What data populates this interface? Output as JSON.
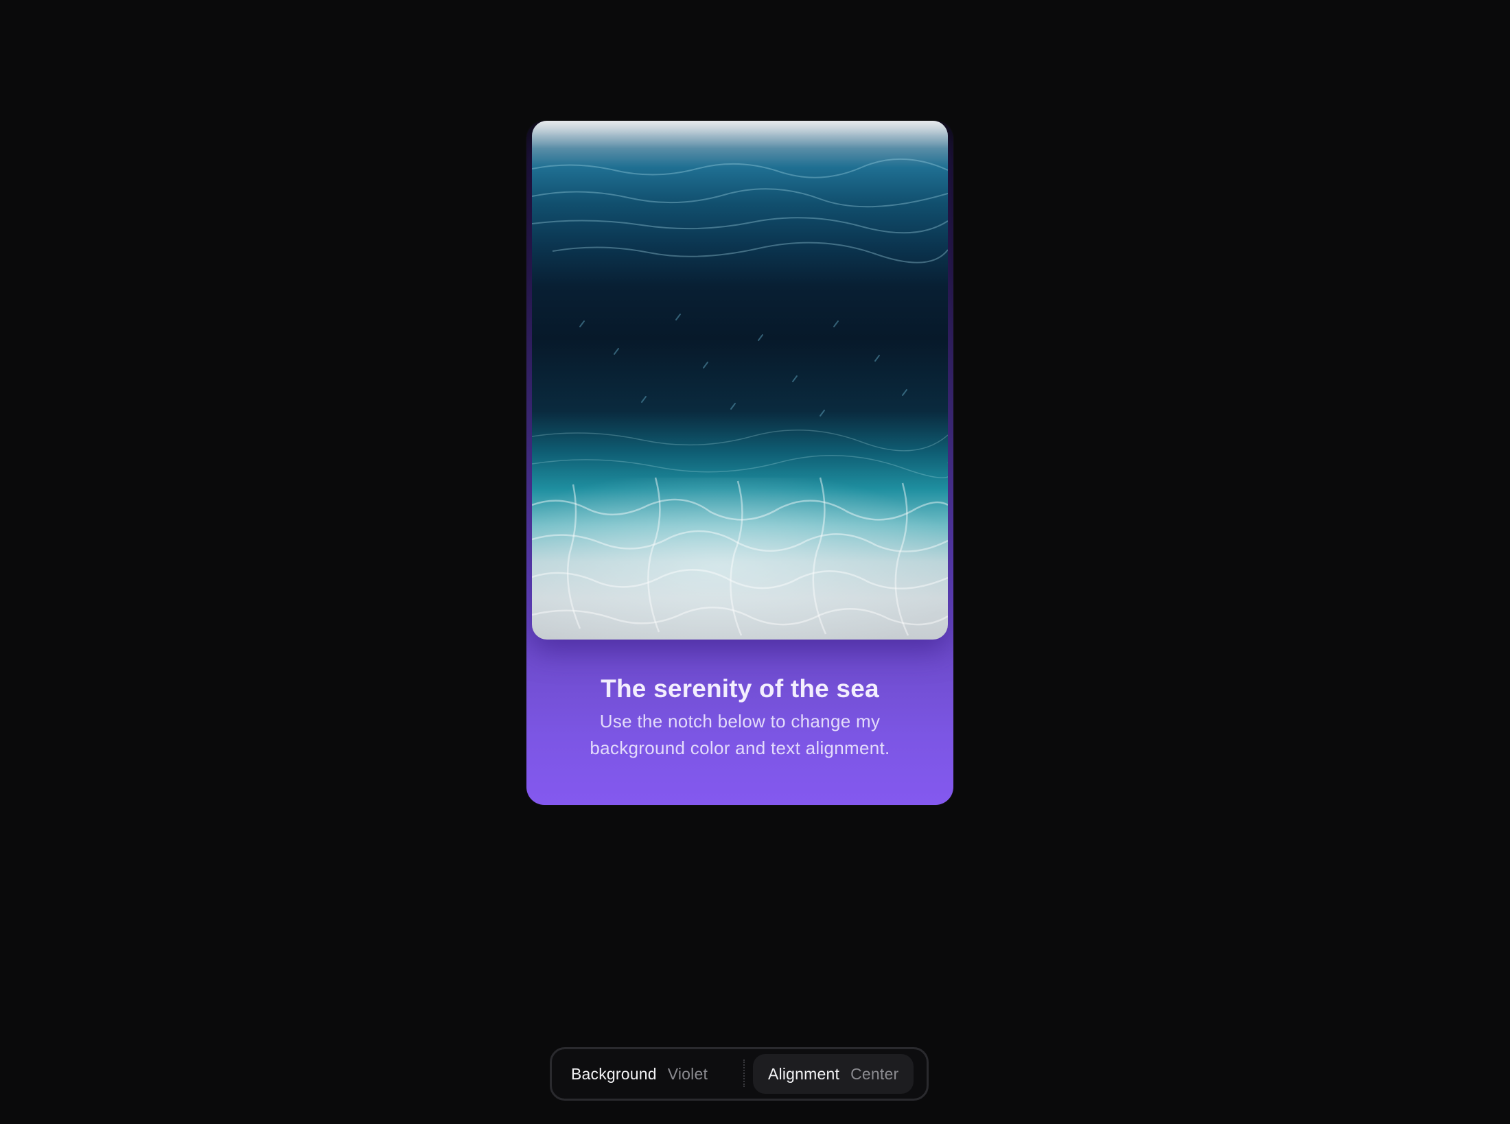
{
  "card": {
    "title": "The serenity of the sea",
    "description": "Use the notch below to change my background color and text alignment.",
    "background_color": "#8459ef"
  },
  "notch": {
    "background": {
      "label": "Background",
      "value": "Violet"
    },
    "alignment": {
      "label": "Alignment",
      "value": "Center",
      "active": true
    }
  }
}
